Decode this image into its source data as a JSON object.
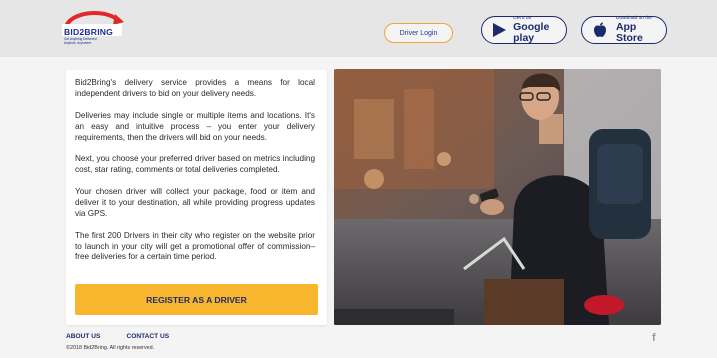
{
  "header": {
    "logo": {
      "brand": "BID2BRING",
      "tagline_line1": "Get Anything Delivered",
      "tagline_line2": "Anytime, Anywhere",
      "colors": {
        "blue": "#1d2b8e",
        "red": "#e02828"
      }
    },
    "driver_login_label": "Driver Login",
    "google_play": {
      "small": "Get it on",
      "big": "Google play",
      "icon": "play-icon"
    },
    "app_store": {
      "small": "Download on the",
      "big": "App Store",
      "icon": "apple-icon"
    }
  },
  "content": {
    "paragraphs": [
      "Bid2Bring's delivery service provides a means for local independent drivers to bid on your delivery needs.",
      "Deliveries may include single or multiple items and locations. It's an easy and intuitive process – you enter your delivery requirements, then the drivers will bid on your needs.",
      "Next, you choose your preferred driver based on metrics including cost, star rating, comments or total deliveries completed.",
      "Your chosen driver will collect your package, food or item and deliver it to your destination, all while providing progress updates via GPS.",
      "The first 200 Drivers in their city who register on the website prior to launch in your city will get a promotional offer of commission–free deliveries for a certain time period."
    ],
    "register_label": "REGISTER AS A DRIVER",
    "accent_color": "#f7b62d"
  },
  "footer": {
    "about_label": "ABOUT US",
    "contact_label": "CONTACT US",
    "copyright": "©2018 Bid2Bring. All rights reserved.",
    "social_icon": "facebook-icon"
  }
}
